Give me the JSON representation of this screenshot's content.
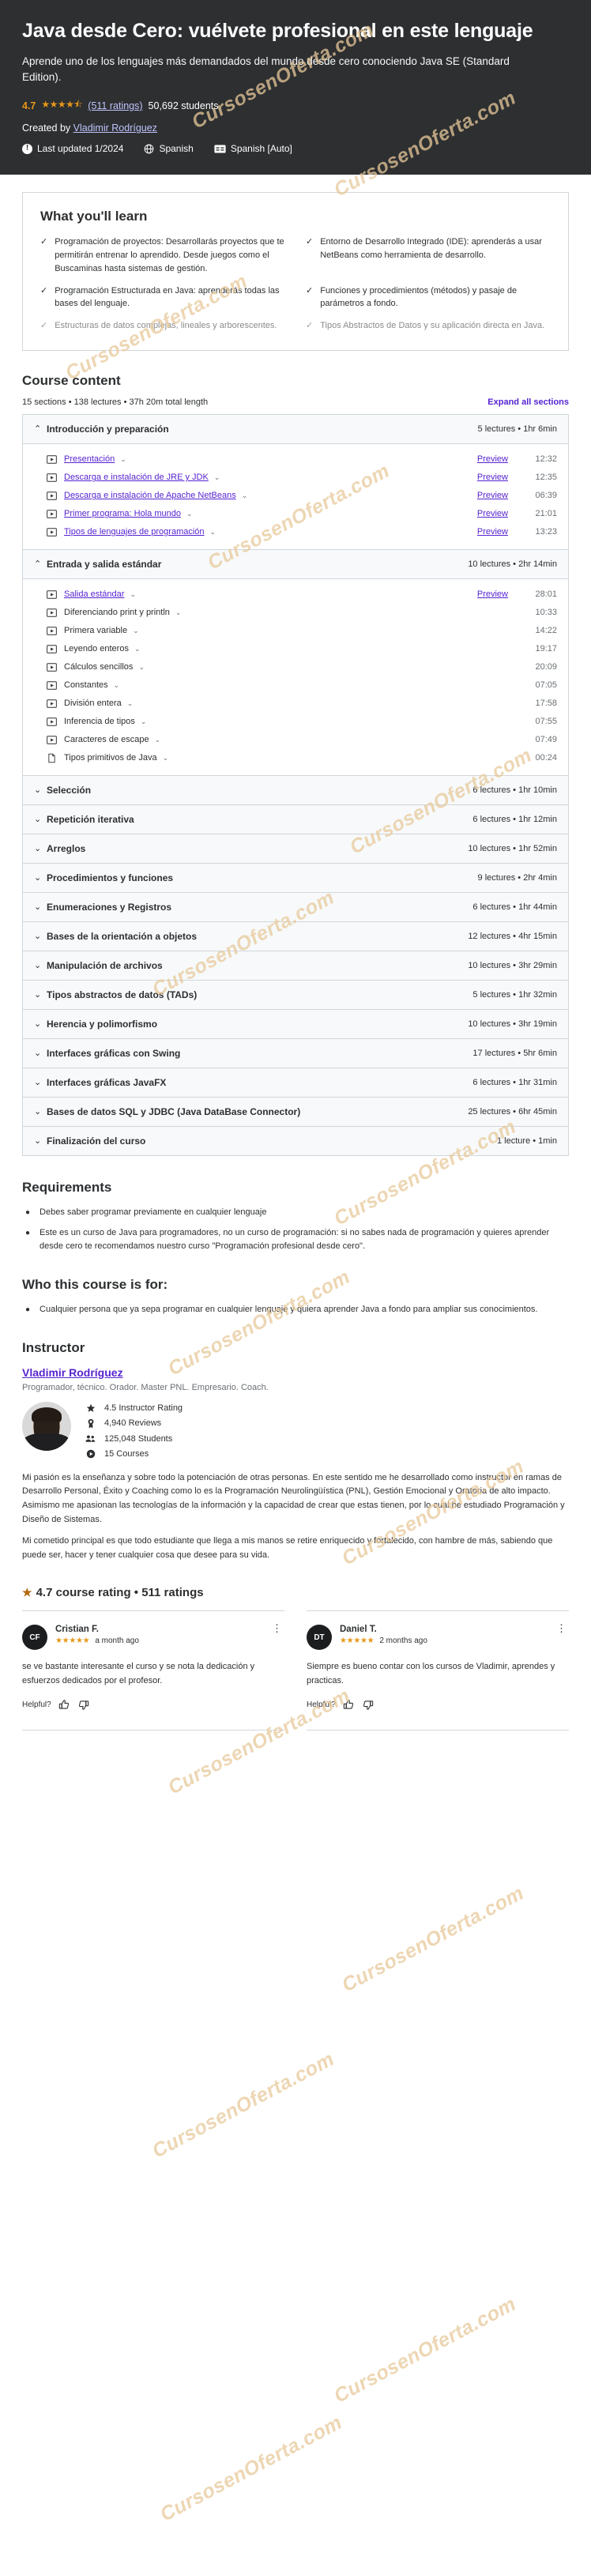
{
  "hero": {
    "title": "Java desde Cero: vuélvete profesional en este lenguaje",
    "subtitle": "Aprende uno de los lenguajes más demandados del mundo desde cero conociendo Java SE (Standard Edition).",
    "rating_value": "4.7",
    "stars": "★★★★⯪",
    "ratings_link": "(511 ratings)",
    "students": "50,692 students",
    "created_by_label": "Created by",
    "instructor_link": "Vladimir Rodríguez",
    "last_updated": "Last updated 1/2024",
    "language": "Spanish",
    "captions": "Spanish [Auto]"
  },
  "watermark_text": "CursosenOferta.com",
  "learn": {
    "heading": "What you'll learn",
    "items": [
      {
        "text": "Programación de proyectos: Desarrollarás proyectos que te permitirán entrenar lo aprendido. Desde juegos como el Buscaminas hasta sistemas de gestión.",
        "faded": false
      },
      {
        "text": "Entorno de Desarrollo Integrado (IDE): aprenderás a usar NetBeans como herramienta de desarrollo.",
        "faded": false
      },
      {
        "text": "Programación Estructurada en Java: aprenderás todas las bases del lenguaje.",
        "faded": false
      },
      {
        "text": "Funciones y procedimientos (métodos) y pasaje de parámetros a fondo.",
        "faded": false
      },
      {
        "text": "Estructuras de datos complejas, lineales y arborescentes.",
        "faded": true
      },
      {
        "text": "Tipos Abstractos de Datos y su aplicación directa en Java.",
        "faded": true
      }
    ],
    "check_glyph": "✓"
  },
  "course_content": {
    "heading": "Course content",
    "summary": "15 sections • 138 lectures • 37h 20m total length",
    "expand_all": "Expand all sections",
    "sections": [
      {
        "title": "Introducción y preparación",
        "meta": "5 lectures • 1hr 6min",
        "expanded": true,
        "chevron": "⌃",
        "lectures": [
          {
            "title": "Presentación",
            "link": true,
            "preview": "Preview",
            "duration": "12:32",
            "icon": "video"
          },
          {
            "title": "Descarga e instalación de JRE y JDK",
            "link": true,
            "preview": "Preview",
            "duration": "12:35",
            "icon": "video"
          },
          {
            "title": "Descarga e instalación de Apache NetBeans",
            "link": true,
            "preview": "Preview",
            "duration": "06:39",
            "icon": "video"
          },
          {
            "title": "Primer programa: Hola mundo",
            "link": true,
            "preview": "Preview",
            "duration": "21:01",
            "icon": "video"
          },
          {
            "title": "Tipos de lenguajes de programación",
            "link": true,
            "preview": "Preview",
            "duration": "13:23",
            "icon": "video"
          }
        ]
      },
      {
        "title": "Entrada y salida estándar",
        "meta": "10 lectures • 2hr 14min",
        "expanded": true,
        "chevron": "⌃",
        "lectures": [
          {
            "title": "Salida estándar",
            "link": true,
            "preview": "Preview",
            "duration": "28:01",
            "icon": "video"
          },
          {
            "title": "Diferenciando print y println",
            "link": false,
            "preview": "",
            "duration": "10:33",
            "icon": "video"
          },
          {
            "title": "Primera variable",
            "link": false,
            "preview": "",
            "duration": "14:22",
            "icon": "video"
          },
          {
            "title": "Leyendo enteros",
            "link": false,
            "preview": "",
            "duration": "19:17",
            "icon": "video"
          },
          {
            "title": "Cálculos sencillos",
            "link": false,
            "preview": "",
            "duration": "20:09",
            "icon": "video"
          },
          {
            "title": "Constantes",
            "link": false,
            "preview": "",
            "duration": "07:05",
            "icon": "video"
          },
          {
            "title": "División entera",
            "link": false,
            "preview": "",
            "duration": "17:58",
            "icon": "video"
          },
          {
            "title": "Inferencia de tipos",
            "link": false,
            "preview": "",
            "duration": "07:55",
            "icon": "video"
          },
          {
            "title": "Caracteres de escape",
            "link": false,
            "preview": "",
            "duration": "07:49",
            "icon": "video"
          },
          {
            "title": "Tipos primitivos de Java",
            "link": false,
            "preview": "",
            "duration": "00:24",
            "icon": "article"
          }
        ]
      },
      {
        "title": "Selección",
        "meta": "6 lectures • 1hr 10min",
        "expanded": false,
        "chevron": "⌄",
        "lectures": []
      },
      {
        "title": "Repetición iterativa",
        "meta": "6 lectures • 1hr 12min",
        "expanded": false,
        "chevron": "⌄",
        "lectures": []
      },
      {
        "title": "Arreglos",
        "meta": "10 lectures • 1hr 52min",
        "expanded": false,
        "chevron": "⌄",
        "lectures": []
      },
      {
        "title": "Procedimientos y funciones",
        "meta": "9 lectures • 2hr 4min",
        "expanded": false,
        "chevron": "⌄",
        "lectures": []
      },
      {
        "title": "Enumeraciones y Registros",
        "meta": "6 lectures • 1hr 44min",
        "expanded": false,
        "chevron": "⌄",
        "lectures": []
      },
      {
        "title": "Bases de la orientación a objetos",
        "meta": "12 lectures • 4hr 15min",
        "expanded": false,
        "chevron": "⌄",
        "lectures": []
      },
      {
        "title": "Manipulación de archivos",
        "meta": "10 lectures • 3hr 29min",
        "expanded": false,
        "chevron": "⌄",
        "lectures": []
      },
      {
        "title": "Tipos abstractos de datos (TADs)",
        "meta": "5 lectures • 1hr 32min",
        "expanded": false,
        "chevron": "⌄",
        "lectures": []
      },
      {
        "title": "Herencia y polimorfismo",
        "meta": "10 lectures • 3hr 19min",
        "expanded": false,
        "chevron": "⌄",
        "lectures": []
      },
      {
        "title": "Interfaces gráficas con Swing",
        "meta": "17 lectures • 5hr 6min",
        "expanded": false,
        "chevron": "⌄",
        "lectures": []
      },
      {
        "title": "Interfaces gráficas JavaFX",
        "meta": "6 lectures • 1hr 31min",
        "expanded": false,
        "chevron": "⌄",
        "lectures": []
      },
      {
        "title": "Bases de datos SQL y JDBC (Java DataBase Connector)",
        "meta": "25 lectures • 6hr 45min",
        "expanded": false,
        "chevron": "⌄",
        "lectures": []
      },
      {
        "title": "Finalización del curso",
        "meta": "1 lecture • 1min",
        "expanded": false,
        "chevron": "⌄",
        "lectures": []
      }
    ]
  },
  "requirements": {
    "heading": "Requirements",
    "items": [
      "Debes saber programar previamente en cualquier lenguaje",
      "Este es un curso de Java para programadores, no un curso de programación: si no sabes nada de programación y quieres aprender desde cero te recomendamos nuestro curso \"Programación profesional desde cero\"."
    ]
  },
  "audience": {
    "heading": "Who this course is for:",
    "items": [
      "Cualquier persona que ya sepa programar en cualquier lenguaje y quiera aprender Java a fondo para ampliar sus conocimientos."
    ]
  },
  "instructor": {
    "heading": "Instructor",
    "name": "Vladimir Rodríguez",
    "role": "Programador, técnico. Orador. Master PNL. Empresario. Coach.",
    "stats": [
      {
        "icon": "star",
        "glyph": "★",
        "text": "4.5 Instructor Rating"
      },
      {
        "icon": "award",
        "glyph": "🏅",
        "text": "4,940 Reviews"
      },
      {
        "icon": "users",
        "glyph": "👥",
        "text": "125,048 Students"
      },
      {
        "icon": "play",
        "glyph": "▶",
        "text": "15 Courses"
      }
    ],
    "bio": [
      "Mi pasión es la enseñanza y sobre todo la potenciación de otras personas. En este sentido me he desarrollado como instructor en ramas de Desarrollo Personal, Éxito y Coaching como lo es la Programación Neurolingüística (PNL), Gestión Emocional y Oratoria de alto impacto. Asimismo me apasionan las tecnologías de la información y la capacidad de crear que estas tienen, por lo cual he estudiado Programación y Diseño de Sistemas.",
      "Mi cometido principal es que todo estudiante que llega a mis manos se retire enriquecido y fortalecido, con hambre de más, sabiendo que puede ser, hacer y tener cualquier cosa que desee para su vida."
    ]
  },
  "reviews": {
    "header_star": "★",
    "header_text": "4.7 course rating • 511 ratings",
    "helpful_label": "Helpful?",
    "items": [
      {
        "initials": "CF",
        "name": "Cristian F.",
        "stars": "★★★★★",
        "ago": "a month ago",
        "text": "se ve bastante interesante el curso y se nota la dedicación y esfuerzos dedicados por el profesor."
      },
      {
        "initials": "DT",
        "name": "Daniel T.",
        "stars": "★★★★★",
        "ago": "2 months ago",
        "text": "Siempre es bueno contar con los cursos de Vladimir, aprendes y practicas."
      }
    ]
  }
}
